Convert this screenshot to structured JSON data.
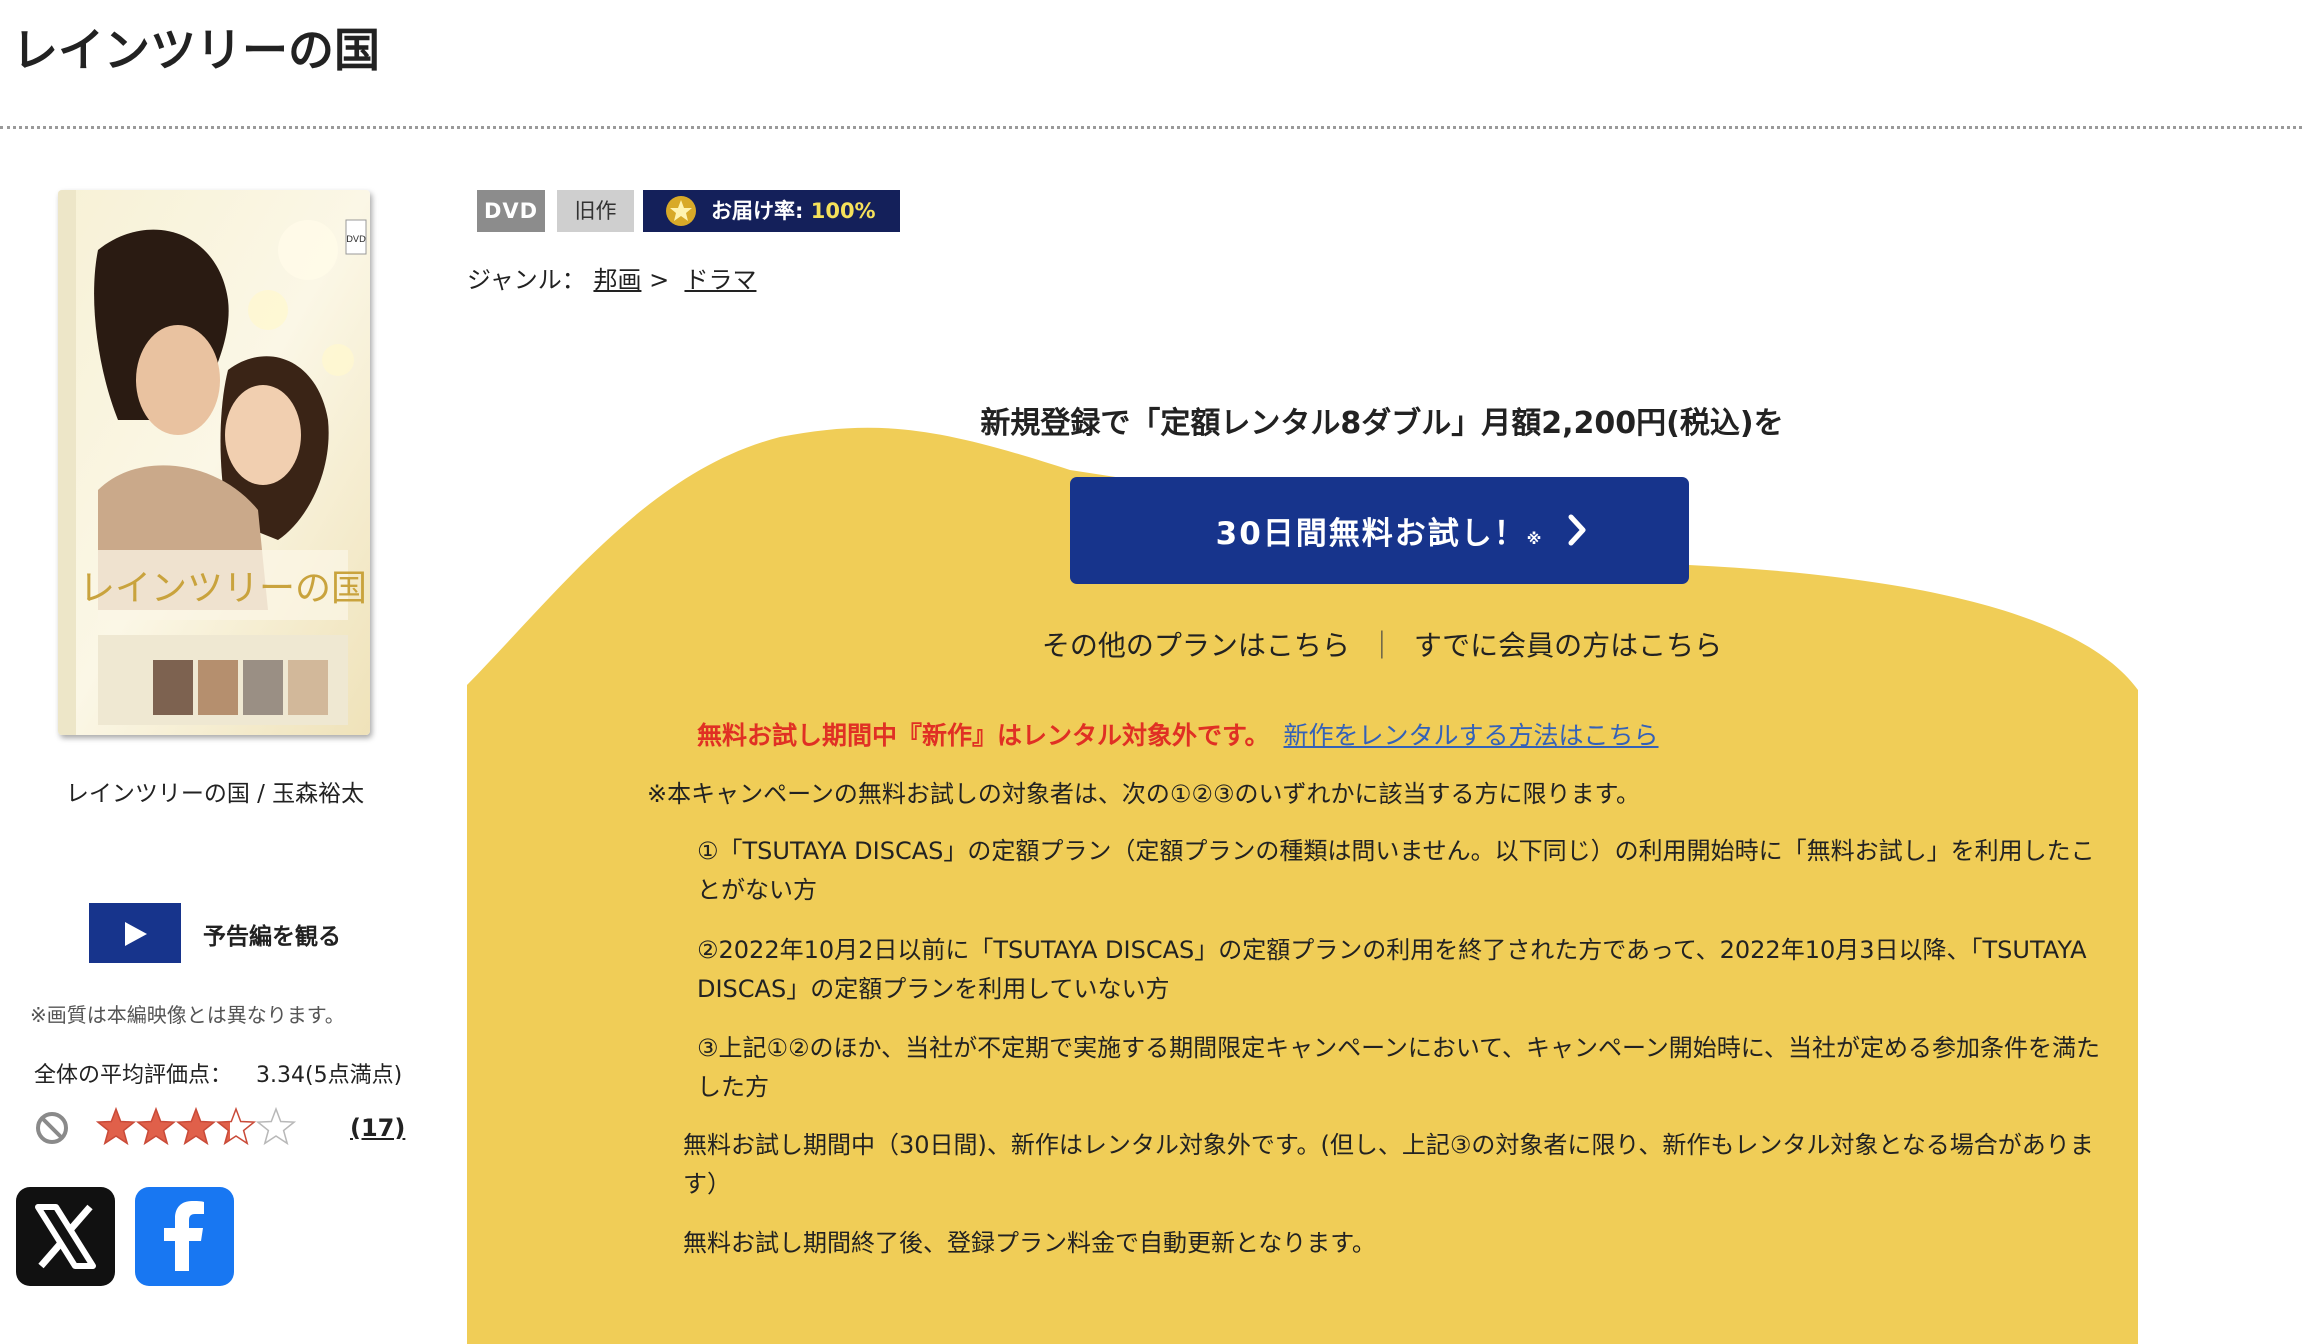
{
  "page": {
    "title": "レインツリーの国"
  },
  "product": {
    "cover_title": "レインツリーの国",
    "caption": "レインツリーの国 / 玉森裕太",
    "trailer_label": "予告編を観る",
    "image_note": "※画質は本編映像とは異なります。",
    "rating": {
      "label": "全体の平均評価点：",
      "value": "3.34(5点満点)",
      "score": 3.34,
      "max": 5,
      "review_count": "(17)"
    }
  },
  "tags": {
    "format": "DVD",
    "category": "旧作",
    "delivery_label": "お届け率:",
    "delivery_value": "100%"
  },
  "genre": {
    "label": "ジャンル：",
    "items": [
      "邦画",
      "ドラマ"
    ],
    "separator": ">"
  },
  "promo": {
    "heading": "新規登録で「定額レンタル8ダブル」月額2,200円(税込)を",
    "button_label": "30日間無料お試し！",
    "button_mark": "※",
    "other_plans": "その他のプランはこちら",
    "divider": "｜",
    "members": "すでに会員の方はこちら",
    "alert_text": "無料お試し期間中『新作』はレンタル対象外です。",
    "alert_link": "新作をレンタルする方法はこちら",
    "note_main": "※本キャンペーンの無料お試しの対象者は、次の①②③のいずれかに該当する方に限ります。",
    "conditions": [
      "①「TSUTAYA DISCAS」の定額プラン（定額プランの種類は問いません。以下同じ）の利用開始時に「無料お試し」を利用したことがない方",
      "②2022年10月2日以前に「TSUTAYA DISCAS」の定額プランの利用を終了された方であって、2022年10月3日以降、「TSUTAYA DISCAS」の定額プランを利用していない方",
      "③上記①②のほか、当社が不定期で実施する期間限定キャンペーンにおいて、キャンペーン開始時に、当社が定める参加条件を満たした方"
    ],
    "note_period": "無料お試し期間中（30日間)、新作はレンタル対象外です。(但し、上記③の対象者に限り、新作もレンタル対象となる場合があります）",
    "note_renew": "無料お試し期間終了後、登録プラン料金で自動更新となります。"
  },
  "colors": {
    "navy": "#17348c",
    "yellow": "#f0cd57",
    "alert_red": "#e03024",
    "link_blue": "#3461b8"
  },
  "icons": {
    "trailer": "play-icon",
    "no_rating": "prohibited-icon",
    "delivery": "star-badge-icon",
    "share_x": "x-logo-icon",
    "share_fb": "facebook-logo-icon"
  }
}
